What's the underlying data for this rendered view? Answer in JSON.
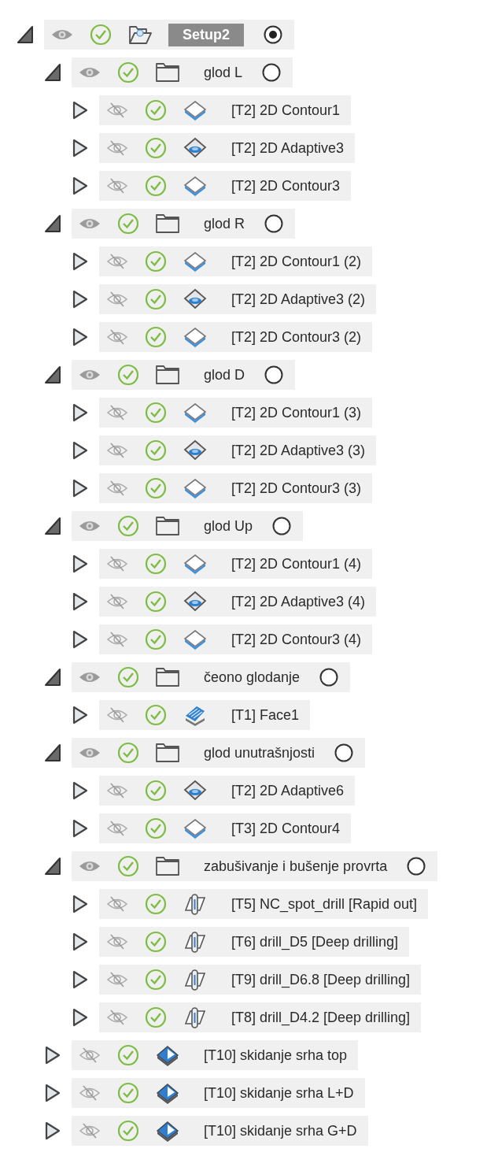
{
  "setup": {
    "kind": "setup",
    "label": "Setup2",
    "expanded": true,
    "visible": true,
    "active": true,
    "children": [
      {
        "kind": "folder",
        "label": "glod L",
        "expanded": true,
        "visible": true,
        "active": false,
        "children": [
          {
            "kind": "contour",
            "label": "[T2] 2D Contour1",
            "expanded": false,
            "visible": false
          },
          {
            "kind": "adaptive",
            "label": "[T2] 2D Adaptive3",
            "expanded": false,
            "visible": false
          },
          {
            "kind": "contour",
            "label": "[T2] 2D Contour3",
            "expanded": false,
            "visible": false
          }
        ]
      },
      {
        "kind": "folder",
        "label": "glod R",
        "expanded": true,
        "visible": true,
        "active": false,
        "children": [
          {
            "kind": "contour",
            "label": "[T2] 2D Contour1 (2)",
            "expanded": false,
            "visible": false
          },
          {
            "kind": "adaptive",
            "label": "[T2] 2D Adaptive3 (2)",
            "expanded": false,
            "visible": false
          },
          {
            "kind": "contour",
            "label": "[T2] 2D Contour3 (2)",
            "expanded": false,
            "visible": false
          }
        ]
      },
      {
        "kind": "folder",
        "label": "glod D",
        "expanded": true,
        "visible": true,
        "active": false,
        "children": [
          {
            "kind": "contour",
            "label": "[T2] 2D Contour1 (3)",
            "expanded": false,
            "visible": false
          },
          {
            "kind": "adaptive",
            "label": "[T2] 2D Adaptive3 (3)",
            "expanded": false,
            "visible": false
          },
          {
            "kind": "contour",
            "label": "[T2] 2D Contour3 (3)",
            "expanded": false,
            "visible": false
          }
        ]
      },
      {
        "kind": "folder",
        "label": "glod Up",
        "expanded": true,
        "visible": true,
        "active": false,
        "children": [
          {
            "kind": "contour",
            "label": "[T2] 2D Contour1 (4)",
            "expanded": false,
            "visible": false
          },
          {
            "kind": "adaptive",
            "label": "[T2] 2D Adaptive3 (4)",
            "expanded": false,
            "visible": false
          },
          {
            "kind": "contour",
            "label": "[T2] 2D Contour3 (4)",
            "expanded": false,
            "visible": false
          }
        ]
      },
      {
        "kind": "folder",
        "label": "čeono glodanje",
        "expanded": true,
        "visible": true,
        "active": false,
        "children": [
          {
            "kind": "face",
            "label": "[T1] Face1",
            "expanded": false,
            "visible": false
          }
        ]
      },
      {
        "kind": "folder",
        "label": "glod unutrašnjosti",
        "expanded": true,
        "visible": true,
        "active": false,
        "children": [
          {
            "kind": "adaptive",
            "label": "[T2] 2D Adaptive6",
            "expanded": false,
            "visible": false
          },
          {
            "kind": "contour",
            "label": "[T3] 2D Contour4",
            "expanded": false,
            "visible": false
          }
        ]
      },
      {
        "kind": "folder",
        "label": "zabušivanje i bušenje provrta",
        "expanded": true,
        "visible": true,
        "active": false,
        "children": [
          {
            "kind": "drill",
            "label": "[T5] NC_spot_drill [Rapid out]",
            "expanded": false,
            "visible": false
          },
          {
            "kind": "drill",
            "label": "[T6] drill_D5 [Deep drilling]",
            "expanded": false,
            "visible": false
          },
          {
            "kind": "drill",
            "label": "[T9] drill_D6.8 [Deep drilling]",
            "expanded": false,
            "visible": false
          },
          {
            "kind": "drill",
            "label": "[T8] drill_D4.2 [Deep drilling]",
            "expanded": false,
            "visible": false
          }
        ]
      },
      {
        "kind": "deburr",
        "label": "[T10] skidanje srha top",
        "expanded": false,
        "visible": false
      },
      {
        "kind": "deburr",
        "label": "[T10] skidanje srha L+D",
        "expanded": false,
        "visible": false
      },
      {
        "kind": "deburr",
        "label": "[T10] skidanje srha G+D",
        "expanded": false,
        "visible": false
      }
    ]
  }
}
